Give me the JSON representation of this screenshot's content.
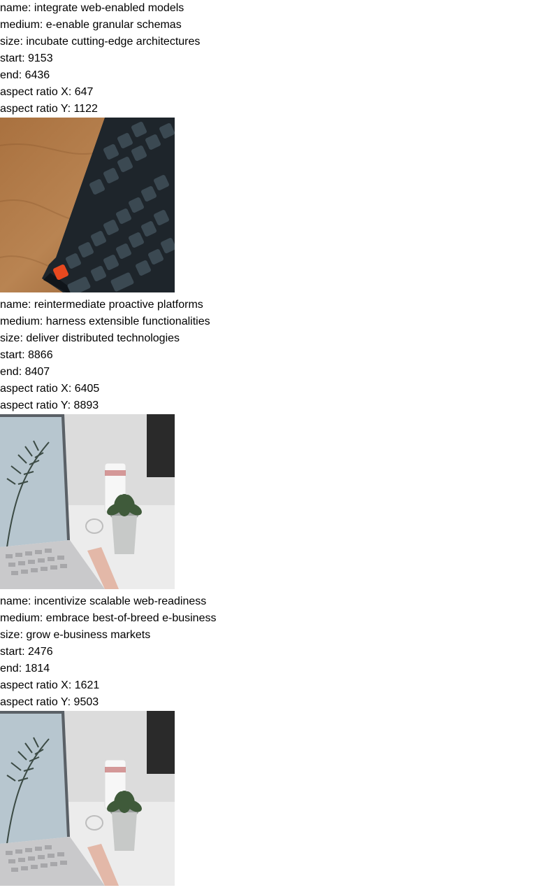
{
  "records": [
    {
      "name_line": "name: integrate web-enabled models",
      "medium_line": "medium: e-enable granular schemas",
      "size_line": "size: incubate cutting-edge architectures",
      "start_line": "start: 9153",
      "end_line": "end: 6436",
      "aspect_x_line": "aspect ratio X: 647",
      "aspect_y_line": "aspect ratio Y: 1122",
      "image": "keyboard-photo"
    },
    {
      "name_line": "name: reintermediate proactive platforms",
      "medium_line": "medium: harness extensible functionalities",
      "size_line": "size: deliver distributed technologies",
      "start_line": "start: 8866",
      "end_line": "end: 8407",
      "aspect_x_line": "aspect ratio X: 6405",
      "aspect_y_line": "aspect ratio Y: 8893",
      "image": "laptop-desk-photo"
    },
    {
      "name_line": "name: incentivize scalable web-readiness",
      "medium_line": "medium: embrace best-of-breed e-business",
      "size_line": "size: grow e-business markets",
      "start_line": "start: 2476",
      "end_line": "end: 1814",
      "aspect_x_line": "aspect ratio X: 1621",
      "aspect_y_line": "aspect ratio Y: 9503",
      "image": "laptop-desk-photo"
    }
  ]
}
